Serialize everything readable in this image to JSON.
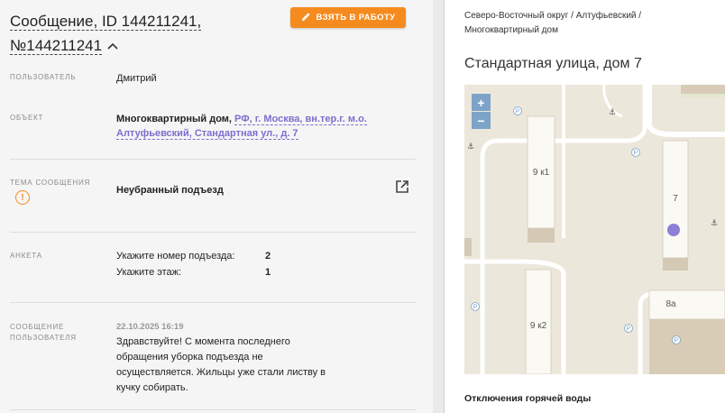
{
  "header": {
    "title_line1": "Сообщение, ID 144211241,",
    "title_line2": "№144211241",
    "take_button": "ВЗЯТЬ В РАБОТУ"
  },
  "fields": {
    "user_label": "ПОЛЬЗОВАТЕЛЬ",
    "user_value": "Дмитрий",
    "object_label": "ОБЪЕКТ",
    "object_type": "Многоквартирный дом,",
    "object_link_line1": "РФ, г. Москва, вн.тер.г. м.о.",
    "object_link_line2": "Алтуфьевский, Стандартная ул., д. 7",
    "topic_label": "ТЕМА СООБЩЕНИЯ",
    "topic_value": "Неубранный подъезд",
    "survey_label": "АНКЕТА",
    "survey": [
      {
        "q": "Укажите номер подъезда:",
        "a": "2"
      },
      {
        "q": "Укажите этаж:",
        "a": "1"
      }
    ],
    "message_label_line1": "СООБЩЕНИЕ",
    "message_label_line2": "ПОЛЬЗОВАТЕЛЯ",
    "message_date": "22.10.2025 16:19",
    "message_text": "Здравствуйте! С момента последнего обращения уборка подъезда не осуществляется. Жильцы уже стали листву в кучку собирать."
  },
  "right": {
    "breadcrumb_line1": "Северо-Восточный округ / Алтуфьевский /",
    "breadcrumb_line2": "Многоквартирный дом",
    "address": "Стандартная улица, дом 7",
    "map": {
      "zoom_in": "+",
      "zoom_out": "−",
      "buildings": [
        "9 к1",
        "7",
        "8а",
        "9 к2"
      ],
      "parking": "P"
    },
    "section_title": "Отключения горячей воды"
  },
  "colors": {
    "accent": "#f58b1f",
    "link": "#7b6fcf",
    "marker": "#8d7fd6",
    "zoom": "#7da3c9"
  }
}
